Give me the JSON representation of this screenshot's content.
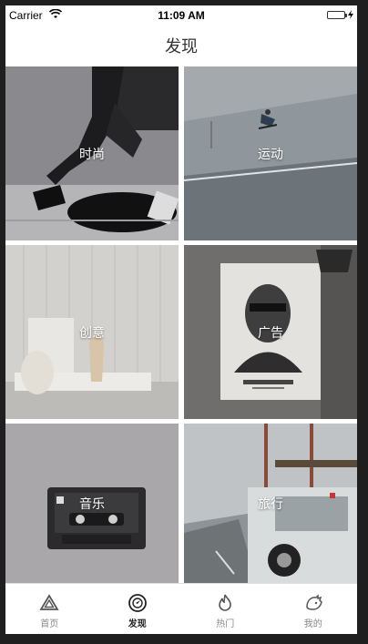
{
  "status": {
    "carrier": "Carrier",
    "time": "11:09 AM"
  },
  "nav": {
    "title": "发现"
  },
  "categories": [
    {
      "label": "时尚"
    },
    {
      "label": "运动"
    },
    {
      "label": "创意"
    },
    {
      "label": "广告"
    },
    {
      "label": "音乐"
    },
    {
      "label": "旅行"
    }
  ],
  "tabs": [
    {
      "label": "首页",
      "icon": "triangle-icon"
    },
    {
      "label": "发现",
      "icon": "compass-icon"
    },
    {
      "label": "热门",
      "icon": "flame-icon"
    },
    {
      "label": "我的",
      "icon": "hedgehog-icon"
    }
  ],
  "active_tab": "发现"
}
